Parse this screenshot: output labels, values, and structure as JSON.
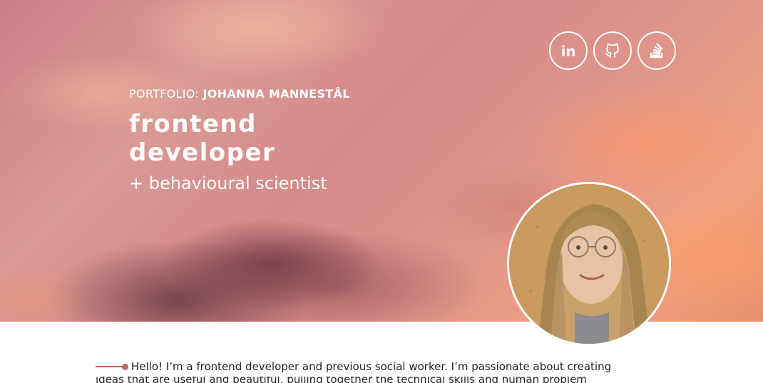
{
  "hero": {
    "kicker_prefix": "PORTFOLIO:",
    "kicker_name": "JOHANNA MANNESTÅL",
    "title_line1": "frontend",
    "title_line2": "developer",
    "subtitle": "+ behavioural scientist"
  },
  "social": [
    {
      "icon": "linkedin-icon",
      "label": "in"
    },
    {
      "icon": "github-icon"
    },
    {
      "icon": "stackoverflow-icon"
    }
  ],
  "avatar": {
    "alt": "profile photo"
  },
  "intro": {
    "line1": "Hello! I’m a frontend developer and previous social worker. I’m passionate about creating",
    "line2": "ideas that are useful and beautiful, pulling together the technical skills and human problem"
  },
  "colors": {
    "accent": "#c0665f",
    "hero_text": "#ffffff"
  }
}
